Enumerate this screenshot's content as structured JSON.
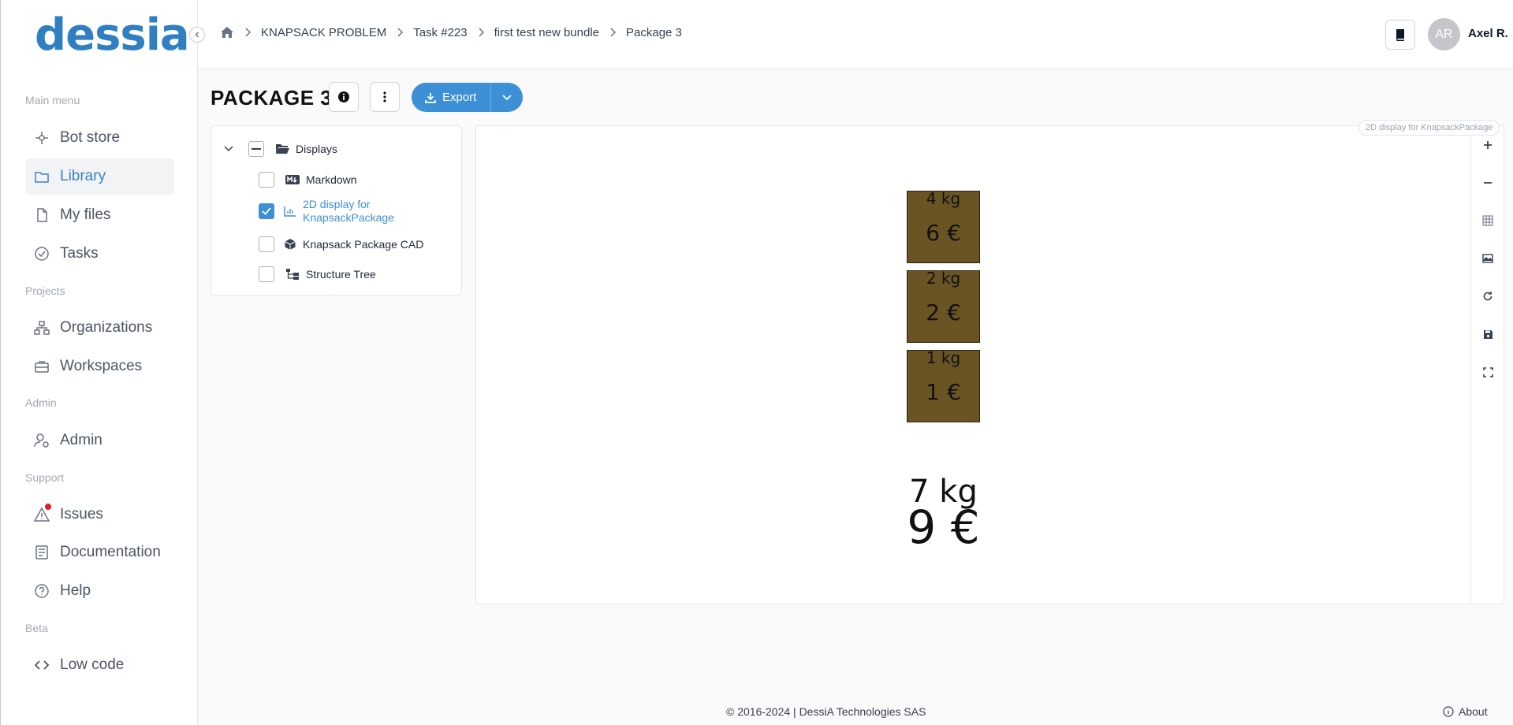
{
  "app": {
    "logo": "dessia"
  },
  "sidebar": {
    "sections": [
      {
        "label": "Main menu"
      },
      {
        "label": "Projects"
      },
      {
        "label": "Admin"
      },
      {
        "label": "Support"
      },
      {
        "label": "Beta"
      }
    ],
    "items": [
      {
        "label": "Bot store",
        "icon": "bot-store-icon"
      },
      {
        "label": "Library",
        "icon": "folder-icon",
        "active": true
      },
      {
        "label": "My files",
        "icon": "file-icon"
      },
      {
        "label": "Tasks",
        "icon": "check-circle-icon"
      },
      {
        "label": "Organizations",
        "icon": "organization-icon"
      },
      {
        "label": "Workspaces",
        "icon": "briefcase-icon"
      },
      {
        "label": "Admin",
        "icon": "user-gear-icon"
      },
      {
        "label": "Issues",
        "icon": "warning-icon",
        "notification": true
      },
      {
        "label": "Documentation",
        "icon": "document-icon"
      },
      {
        "label": "Help",
        "icon": "help-icon"
      },
      {
        "label": "Low code",
        "icon": "code-icon"
      }
    ]
  },
  "header": {
    "breadcrumbs": [
      "KNAPSACK PROBLEM",
      "Task #223",
      "first test new bundle",
      "Package 3"
    ],
    "user": {
      "initials": "AR",
      "name": "Axel R."
    }
  },
  "page": {
    "title": "PACKAGE 3",
    "export_label": "Export"
  },
  "tree": {
    "root": {
      "label": "Displays"
    },
    "children": [
      {
        "label": "Markdown",
        "checked": false,
        "icon": "markdown-icon"
      },
      {
        "label": "2D display for KnapsackPackage",
        "checked": true,
        "icon": "chart-icon"
      },
      {
        "label": "Knapsack Package CAD",
        "checked": false,
        "icon": "cube-icon"
      },
      {
        "label": "Structure Tree",
        "checked": false,
        "icon": "structure-tree-icon"
      }
    ]
  },
  "canvas": {
    "tag": "2D display for KnapsackPackage",
    "box_color": "#6b5424",
    "items": [
      {
        "weight": "4 kg",
        "price": "6 €"
      },
      {
        "weight": "2 kg",
        "price": "2 €"
      },
      {
        "weight": "1 kg",
        "price": "1 €"
      }
    ],
    "total": {
      "weight": "7 kg",
      "price": "9 €"
    },
    "tools": [
      "zoom-in-icon",
      "zoom-out-icon",
      "grid-icon",
      "image-icon",
      "reset-icon",
      "save-icon",
      "fullscreen-icon"
    ]
  },
  "footer": {
    "copyright": "© 2016-2024 | DessiA Technologies SAS",
    "about_label": "About"
  },
  "colors": {
    "accent": "#3d8fd6",
    "logo": "#2f7fc1"
  }
}
